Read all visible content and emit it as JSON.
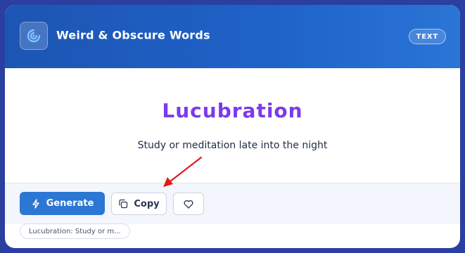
{
  "header": {
    "title": "Weird & Obscure Words",
    "badge": "TEXT",
    "logo_icon": "swirl-icon"
  },
  "result": {
    "word": "Lucubration",
    "definition": "Study or meditation late into the night",
    "word_color": "#7c3aed"
  },
  "actions": {
    "generate_label": "Generate",
    "generate_icon": "lightning-icon",
    "copy_label": "Copy",
    "copy_icon": "copy-icon",
    "favorite_icon": "heart-icon"
  },
  "history": {
    "items": [
      "Lucubration: Study or m..."
    ]
  },
  "colors": {
    "accent": "#2c77d3",
    "header": "#1f5fc6",
    "annotation_arrow": "#e01919"
  }
}
